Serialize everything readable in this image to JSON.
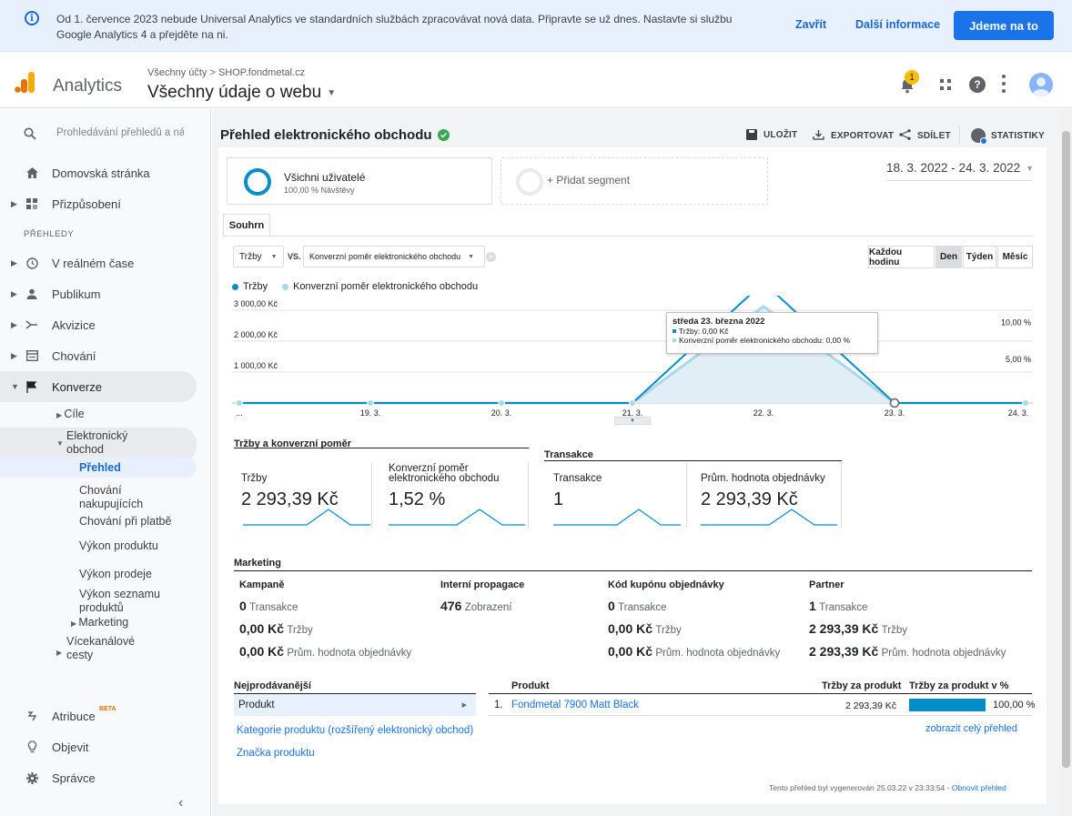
{
  "banner": {
    "text": "Od 1. července 2023 nebude Universal Analytics ve standardních službách zpracovávat nová data. Připravte se už dnes. Nastavte si službu Google Analytics 4 a přejděte na ni.",
    "close": "Zavřít",
    "more": "Další informace",
    "cta": "Jdeme na to"
  },
  "header": {
    "app_name": "Analytics",
    "breadcrumb": "Všechny účty > SHOP.fondmetal.cz",
    "view": "Všechny údaje o webu",
    "notif_count": "1"
  },
  "sidebar": {
    "search_placeholder": "Prohledávání přehledů a náp",
    "home": "Domovská stránka",
    "custom": "Přizpůsobení",
    "section": "PŘEHLEDY",
    "realtime": "V reálném čase",
    "audience": "Publikum",
    "acquisition": "Akvizice",
    "behavior": "Chování",
    "conversions": "Konverze",
    "goals": "Cíle",
    "ecommerce1": "Elektronický",
    "ecommerce2": "obchod",
    "overview": "Přehled",
    "shopping1": "Chování",
    "shopping2": "nakupujících",
    "checkout": "Chování při platbě",
    "product_perf": "Výkon produktu",
    "sales_perf": "Výkon prodeje",
    "list1": "Výkon seznamu",
    "list2": "produktů",
    "marketing": "Marketing",
    "mcf1": "Vícekanálové",
    "mcf2": "cesty",
    "attribution": "Atribuce",
    "beta": "BETA",
    "discover": "Objevit",
    "admin": "Správce"
  },
  "report": {
    "title": "Přehled elektronického obchodu",
    "save": "ULOŽIT",
    "export": "EXPORTOVAT",
    "share": "SDÍLET",
    "insights": "STATISTIKY",
    "segment_name": "Všichni uživatelé",
    "segment_sub": "100,00 % Návštěvy",
    "add_segment": "+ Přidat segment",
    "date_range": "18. 3. 2022 - 24. 3. 2022",
    "tab": "Souhrn",
    "metric1": "Tržby",
    "vs": "VS.",
    "metric2": "Konverzní poměr elektronického obchodu",
    "gran": [
      "Každou hodinu",
      "Den",
      "Týden",
      "Měsíc"
    ]
  },
  "chart_data": {
    "type": "area",
    "series": [
      {
        "name": "Tržby",
        "values": [
          0,
          0,
          0,
          0,
          3900,
          0,
          0
        ],
        "color": "#058dc7"
      },
      {
        "name": "Konverzní poměr elektronického obchodu",
        "values": [
          0,
          0,
          0,
          0,
          13,
          0,
          0
        ],
        "color": "#50b4dc"
      }
    ],
    "categories": [
      "...",
      "19. 3.",
      "20. 3.",
      "21. 3.",
      "22. 3.",
      "23. 3.",
      "24. 3."
    ],
    "y_left_ticks": [
      "3 000,00 Kč",
      "2 000,00 Kč",
      "1 000,00 Kč"
    ],
    "y_right_ticks": [
      "10,00 %",
      "5,00 %"
    ],
    "tooltip": {
      "date": "středa 23. března 2022",
      "line1": "Tržby: 0,00 Kč",
      "line2": "Konverzní poměr elektronického obchodu: 0,00 %"
    }
  },
  "kpis": {
    "group1": "Tržby a konverzní poměr",
    "group2": "Transakce",
    "revenue_label": "Tržby",
    "revenue_value": "2 293,39 Kč",
    "conv_label1": "Konverzní poměr",
    "conv_label2": "elektronického obchodu",
    "conv_value": "1,52 %",
    "tx_label": "Transakce",
    "tx_value": "1",
    "aov_label": "Prům. hodnota objednávky",
    "aov_value": "2 293,39 Kč"
  },
  "marketing": {
    "title": "Marketing",
    "campaigns": {
      "h": "Kampaně",
      "v1": "0",
      "l1": "Transakce",
      "v2": "0,00 Kč",
      "l2": "Tržby",
      "v3": "0,00 Kč",
      "l3": "Prům. hodnota objednávky"
    },
    "internal": {
      "h": "Interní propagace",
      "v1": "476",
      "l1": "Zobrazení"
    },
    "coupon": {
      "h": "Kód kupónu objednávky",
      "v1": "0",
      "l1": "Transakce",
      "v2": "0,00 Kč",
      "l2": "Tržby",
      "v3": "0,00 Kč",
      "l3": "Prům. hodnota objednávky"
    },
    "affiliate": {
      "h": "Partner",
      "v1": "1",
      "l1": "Transakce",
      "v2": "2 293,39 Kč",
      "l2": "Tržby",
      "v3": "2 293,39 Kč",
      "l3": "Prům. hodnota objednávky"
    }
  },
  "top": {
    "title": "Nejprodávanější",
    "product": "Produkt",
    "category": "Kategorie produktu (rozšířený elektronický obchod)",
    "brand": "Značka produktu",
    "col_product": "Produkt",
    "col_rev": "Tržby za produkt",
    "col_pct": "Tržby za produkt v %",
    "row_num": "1.",
    "row_name": "Fondmetal 7900 Matt Black",
    "row_rev": "2 293,39 Kč",
    "row_pct": "100,00 %",
    "row_pct_fill": 1.0,
    "full_report": "zobrazit celý přehled"
  },
  "footer": {
    "generated": "Tento přehled byl vygenerován 25.03.22 v 23:33:54 - ",
    "refresh": "Obnovit přehled"
  },
  "colors": {
    "primary": "#1a73e8",
    "series1": "#058dc7",
    "series2": "#50b4dc",
    "notif": "#fbbc04",
    "logo1": "#f9ab00",
    "logo2": "#e37400"
  }
}
